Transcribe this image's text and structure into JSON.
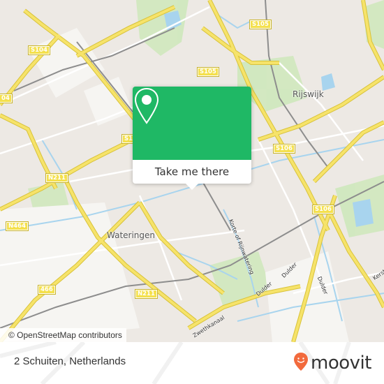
{
  "map": {
    "place_labels": [
      {
        "id": "rijswijk",
        "text": "Rijswijk"
      },
      {
        "id": "wateringen",
        "text": "Wateringen"
      }
    ],
    "road_shields": [
      {
        "id": "s104-a",
        "text": "S104"
      },
      {
        "id": "s104-b",
        "text": "04"
      },
      {
        "id": "s105-a",
        "text": "S105"
      },
      {
        "id": "s105-b",
        "text": "S105"
      },
      {
        "id": "s106-a",
        "text": "S106"
      },
      {
        "id": "s106-b",
        "text": "S106"
      },
      {
        "id": "s1-partial",
        "text": "S1"
      },
      {
        "id": "n211-a",
        "text": "N211"
      },
      {
        "id": "n211-b",
        "text": "N211"
      },
      {
        "id": "n464",
        "text": "N464"
      },
      {
        "id": "r466",
        "text": "466"
      }
    ],
    "street_labels": [
      {
        "id": "korte-rijnwatering",
        "text": "Korte of Rijnwatering"
      },
      {
        "id": "dulder-1",
        "text": "Dulder"
      },
      {
        "id": "dulder-2",
        "text": "Dulder"
      },
      {
        "id": "dulder-3",
        "text": "Dulder"
      },
      {
        "id": "kerst",
        "text": "Kerst"
      },
      {
        "id": "zweth",
        "text": "Zwethkanaal"
      }
    ],
    "colors": {
      "background": "#ede9e4",
      "major_road": "#f4e04d",
      "water": "#a8d4ee",
      "park": "#c8e6b0",
      "rail": "#888888"
    }
  },
  "popup": {
    "icon": "map-pin-icon",
    "button_label": "Take me there",
    "accent_color": "#1fb865"
  },
  "attribution": {
    "text": "© OpenStreetMap contributors"
  },
  "footer": {
    "address": "2 Schuiten, Netherlands",
    "brand": "moovit",
    "brand_color": "#f26a3d"
  }
}
